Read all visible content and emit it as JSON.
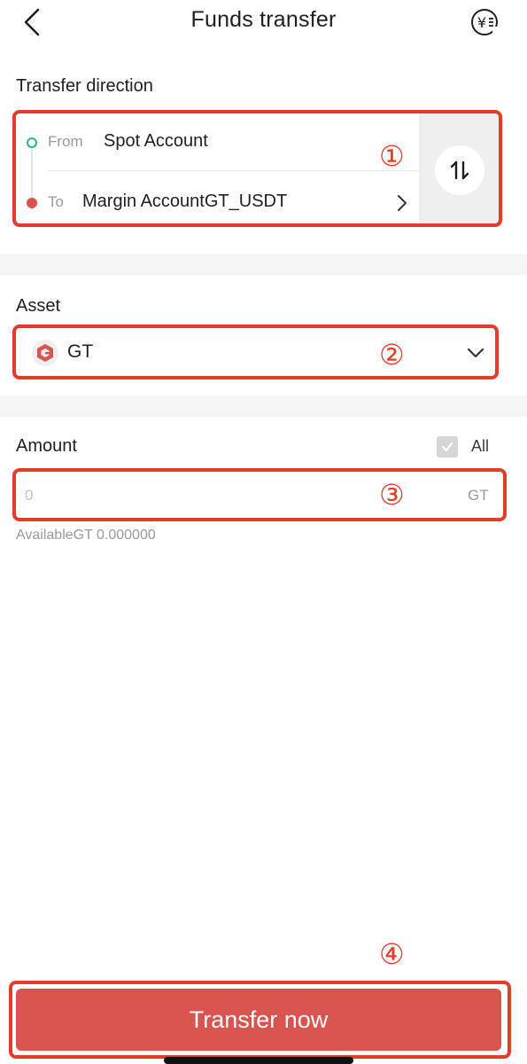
{
  "header": {
    "title": "Funds transfer",
    "back_icon": "chevron-left-icon",
    "right_icon": "yuan-currency-icon",
    "right_icon_glyph": "¥"
  },
  "transfer_direction": {
    "label": "Transfer direction",
    "from_tag": "From",
    "from_value": "Spot Account",
    "to_tag": "To",
    "to_value": "Margin AccountGT_USDT",
    "swap_icon": "swap-vertical-icon"
  },
  "asset": {
    "label": "Asset",
    "selected": "GT",
    "logo_icon": "gt-token-icon"
  },
  "amount": {
    "label": "Amount",
    "all_label": "All",
    "placeholder": "0",
    "value": "",
    "unit": "GT",
    "available": "AvailableGT 0.000000"
  },
  "annotations": [
    "①",
    "②",
    "③",
    "④"
  ],
  "colors": {
    "accent": "#d9534f",
    "annotation": "#e23d2b",
    "from_dot": "#29b58c"
  },
  "footer": {
    "transfer_label": "Transfer now"
  }
}
